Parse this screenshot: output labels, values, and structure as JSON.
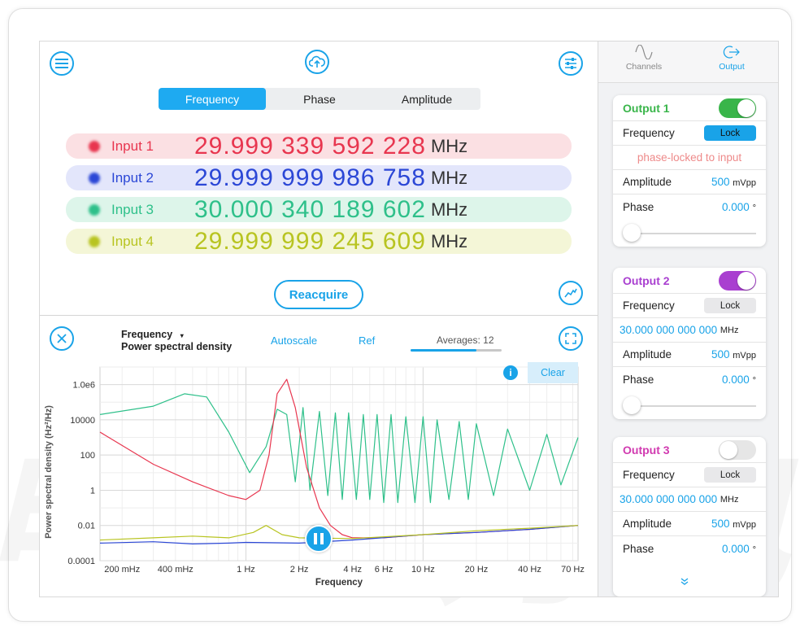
{
  "header": {
    "tabs": [
      "Frequency",
      "Phase",
      "Amplitude"
    ],
    "active_tab": 0
  },
  "inputs": [
    {
      "label": "Input 1",
      "value": "29.999 339 592 228",
      "unit": "MHz",
      "color": "#e8364f",
      "bg": "#fbe0e3"
    },
    {
      "label": "Input 2",
      "value": "29.999 999 986 758",
      "unit": "MHz",
      "color": "#2b47d6",
      "bg": "#e3e6fb"
    },
    {
      "label": "Input 3",
      "value": "30.000 340 189 602",
      "unit": "MHz",
      "color": "#2ec08a",
      "bg": "#ddf5ea"
    },
    {
      "label": "Input 4",
      "value": "29.999 999 245 609",
      "unit": "MHz",
      "color": "#b8c421",
      "bg": "#f4f6d7"
    }
  ],
  "reacquire_label": "Reacquire",
  "plot_controls": {
    "mode": "Frequency",
    "mode_caret": "▾",
    "submode": "Power spectral density",
    "autoscale": "Autoscale",
    "ref": "Ref",
    "averages": "Averages: 12",
    "averages_fill": 0.72,
    "clear": "Clear"
  },
  "icons": {
    "menu": "menu-icon",
    "upload": "cloud-upload-icon",
    "settings": "sliders-icon",
    "trend": "trend-icon",
    "close": "close-icon",
    "expand": "expand-icon",
    "info": "info-icon",
    "pause": "pause-icon",
    "more": "chevron-double-down-icon",
    "channels": "sine-wave-icon",
    "output": "output-arrow-icon"
  },
  "chart_data": {
    "type": "line",
    "xlabel": "Frequency",
    "ylabel": "Power spectral density (Hz²/Hz)",
    "xscale": "log",
    "yscale": "log",
    "xlim": [
      0.15,
      75
    ],
    "ylim": [
      0.0001,
      10000000
    ],
    "x_ticks": [
      "200 mHz",
      "400 mHz",
      "1 Hz",
      "2 Hz",
      "4 Hz",
      "6 Hz",
      "10 Hz",
      "20 Hz",
      "40 Hz",
      "70 Hz"
    ],
    "x_tick_values": [
      0.2,
      0.4,
      1,
      2,
      4,
      6,
      10,
      20,
      40,
      70
    ],
    "y_ticks": [
      "1.0e6",
      "10000",
      "100",
      "1",
      "0.01",
      "0.0001"
    ],
    "y_tick_values": [
      1000000,
      10000,
      100,
      1,
      0.01,
      0.0001
    ],
    "grid": true,
    "series": [
      {
        "color": "#2ec08a",
        "x": [
          0.15,
          0.3,
          0.45,
          0.6,
          0.8,
          1.05,
          1.3,
          1.5,
          1.7,
          1.9,
          2.1,
          2.3,
          2.6,
          2.9,
          3.2,
          3.5,
          3.8,
          4.2,
          4.6,
          5.0,
          5.5,
          6.0,
          6.6,
          7.2,
          8,
          9,
          10,
          11,
          12,
          14,
          16,
          18,
          20,
          25,
          30,
          40,
          50,
          60,
          75
        ],
        "values": [
          20000,
          60000,
          300000,
          200000,
          2000,
          10,
          300,
          40000,
          20000,
          3,
          50000,
          1,
          30000,
          0.5,
          25000,
          0.3,
          25000,
          0.3,
          20000,
          0.3,
          20000,
          0.2,
          20000,
          0.2,
          15000,
          0.2,
          15000,
          0.2,
          10000,
          0.3,
          8000,
          0.3,
          6000,
          0.5,
          3000,
          1,
          1500,
          2,
          1000
        ]
      },
      {
        "color": "#e8364f",
        "x": [
          0.15,
          0.3,
          0.5,
          0.8,
          1.0,
          1.2,
          1.35,
          1.5,
          1.7,
          1.9,
          2.2,
          2.6,
          3.0,
          3.5,
          4,
          6,
          10,
          20,
          40,
          75
        ],
        "values": [
          2000,
          30,
          3,
          0.5,
          0.3,
          1,
          100,
          300000,
          2000000,
          50000,
          20,
          0.1,
          0.01,
          0.003,
          0.002,
          0.002,
          0.003,
          0.004,
          0.006,
          0.01
        ]
      },
      {
        "color": "#2b47d6",
        "x": [
          0.15,
          0.3,
          0.5,
          0.8,
          1,
          2,
          4,
          10,
          20,
          40,
          75
        ],
        "values": [
          0.001,
          0.0012,
          0.0009,
          0.001,
          0.0011,
          0.001,
          0.0015,
          0.003,
          0.004,
          0.006,
          0.01
        ]
      },
      {
        "color": "#b8c421",
        "x": [
          0.15,
          0.3,
          0.5,
          0.8,
          1.1,
          1.3,
          1.6,
          2,
          4,
          10,
          20,
          40,
          75
        ],
        "values": [
          0.0015,
          0.002,
          0.0025,
          0.002,
          0.004,
          0.01,
          0.003,
          0.002,
          0.0018,
          0.003,
          0.005,
          0.007,
          0.01
        ]
      }
    ]
  },
  "sidebar": {
    "tabs": [
      {
        "label": "Channels",
        "active": false
      },
      {
        "label": "Output",
        "active": true
      }
    ],
    "outputs": [
      {
        "title": "Output 1",
        "color": "#39b54a",
        "on": true,
        "frequency_label": "Frequency",
        "lock_label": "Lock",
        "locked": true,
        "frequency_value": "phase-locked to input",
        "frequency_is_note": true,
        "amplitude_label": "Amplitude",
        "amplitude_value": "500",
        "amplitude_unit": "mVpp",
        "phase_label": "Phase",
        "phase_value": "0.000",
        "phase_unit": "°",
        "phase_fraction": 0
      },
      {
        "title": "Output 2",
        "color": "#a93fd0",
        "on": true,
        "frequency_label": "Frequency",
        "lock_label": "Lock",
        "locked": false,
        "frequency_value": "30.000 000 000 000",
        "frequency_unit": "MHz",
        "frequency_is_note": false,
        "amplitude_label": "Amplitude",
        "amplitude_value": "500",
        "amplitude_unit": "mVpp",
        "phase_label": "Phase",
        "phase_value": "0.000",
        "phase_unit": "°",
        "phase_fraction": 0
      },
      {
        "title": "Output 3",
        "color": "#d13ab0",
        "on": false,
        "frequency_label": "Frequency",
        "lock_label": "Lock",
        "locked": false,
        "frequency_value": "30.000 000 000 000",
        "frequency_unit": "MHz",
        "frequency_is_note": false,
        "amplitude_label": "Amplitude",
        "amplitude_value": "500",
        "amplitude_unit": "mVpp",
        "phase_label": "Phase",
        "phase_value": "0.000",
        "phase_unit": "°"
      }
    ]
  },
  "colors": {
    "accent": "#19a3e8"
  }
}
